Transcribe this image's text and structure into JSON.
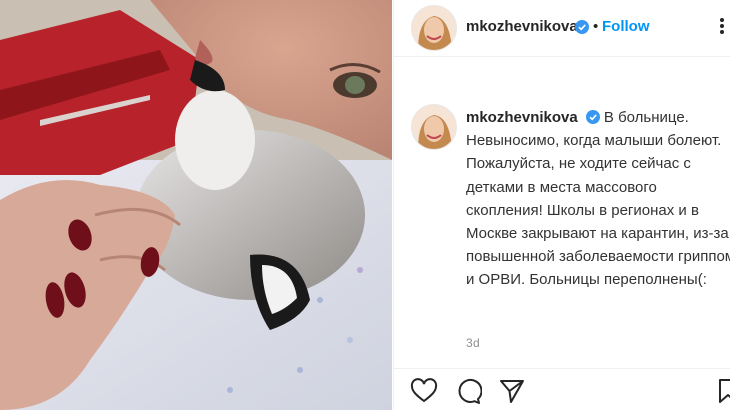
{
  "post": {
    "username": "mkozhevnikova",
    "follow_separator": "•",
    "follow_label": "Follow",
    "caption_username": "mkozhevnikova",
    "caption_text": "В больнице. Невыносимо, когда малыши болеют. Пожалуйста, не ходите сейчас с детками в места массового скопления! Школы в регионах и в Москве закрывают на карантин, из-за повышенной заболеваемости гриппом и ОРВИ. Больницы переполнены(:",
    "timestamp": "3d"
  },
  "icons": {
    "verified": "verified-badge-icon",
    "more": "more-options-icon",
    "like": "heart-icon",
    "comment": "comment-icon",
    "share": "paper-plane-icon",
    "save": "bookmark-icon"
  },
  "colors": {
    "follow": "#0095f6",
    "verified": "#3897f0",
    "text": "#262626",
    "muted": "#8e8e8e"
  }
}
